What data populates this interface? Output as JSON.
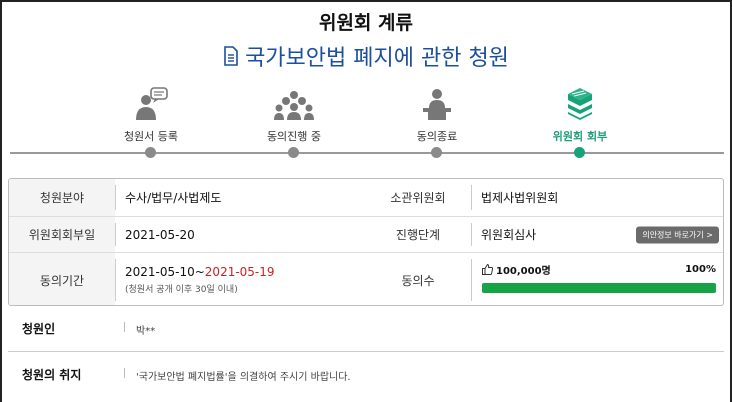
{
  "status": {
    "title": "위원회 계류"
  },
  "petition": {
    "title": "국가보안법 폐지에 관한 청원"
  },
  "steps": [
    {
      "label": "청원서 등록",
      "icon": "speech-person-icon"
    },
    {
      "label": "동의진행 중",
      "icon": "crowd-icon"
    },
    {
      "label": "동의종료",
      "icon": "speaker-podium-icon"
    },
    {
      "label": "위원회 회부",
      "icon": "document-stack-icon",
      "active": true
    }
  ],
  "info": {
    "field_label": "청원분야",
    "field_value": "수사/법무/사법제도",
    "committee_label": "소관위원회",
    "committee_value": "법제사법위원회",
    "referral_label": "위원회회부일",
    "referral_value": "2021-05-20",
    "stage_label": "진행단계",
    "stage_value": "위원회심사",
    "link_button": "의안정보 바로가기 >",
    "period_label": "동의기간",
    "period_start": "2021-05-10~",
    "period_end": "2021-05-19",
    "period_note": "(청원서 공개 이후 30일 이내)",
    "signatures_label": "동의수",
    "signatures_count": "100,000명",
    "signatures_percent": "100%",
    "signatures_progress": 1.0
  },
  "petitioner": {
    "label": "청원인",
    "value": "박**"
  },
  "purpose": {
    "label": "청원의 취지",
    "value": "'국가보안법 폐지법률'을 의결하여 주시기 바랍니다."
  },
  "colors": {
    "accent": "#17a37a",
    "title_blue": "#1c4f9c",
    "progress": "#17a447",
    "period_end": "#d12020"
  }
}
